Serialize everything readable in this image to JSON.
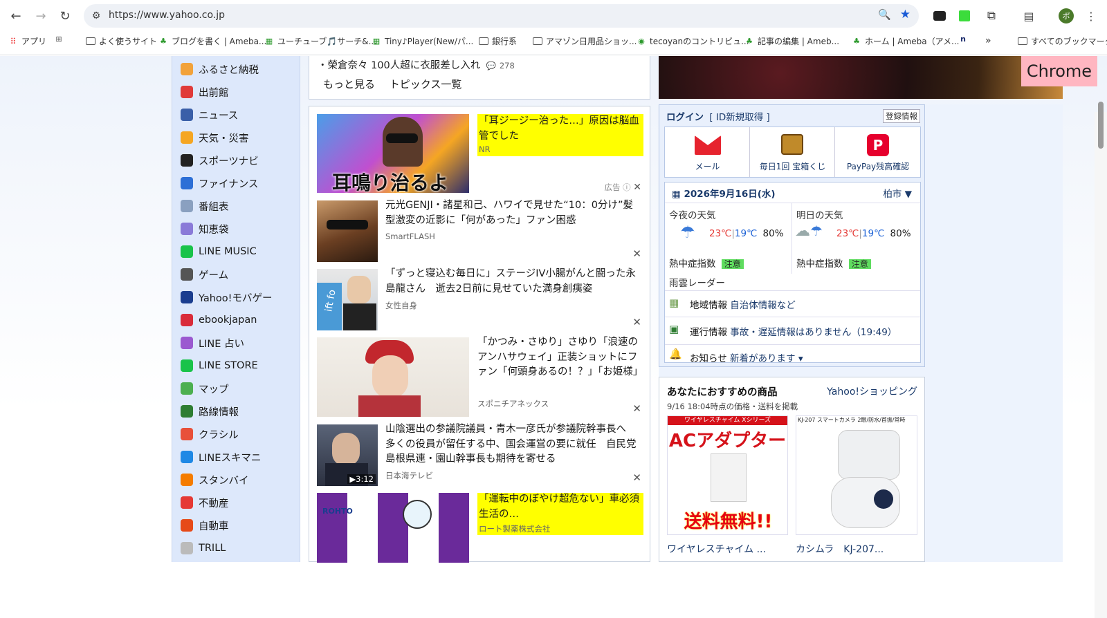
{
  "browser": {
    "url": "https://www.yahoo.co.jp",
    "profile_initial": "ポ"
  },
  "bookmarks": [
    {
      "label": "アプリ"
    },
    {
      "label": "よく使うサイト"
    },
    {
      "label": "ブログを書く | Ameba..."
    },
    {
      "label": "ユーチューブ🎵サーチ&..."
    },
    {
      "label": "Tiny♪Player(New/パ..."
    },
    {
      "label": "銀行系"
    },
    {
      "label": "アマゾン日用品ショッ..."
    },
    {
      "label": "tecoyanのコントリビュ..."
    },
    {
      "label": "記事の編集 | Ameb..."
    },
    {
      "label": "ホーム | Ameba（アメ..."
    },
    {
      "label": "»"
    },
    {
      "label": "すべてのブックマーク"
    }
  ],
  "sidebar": {
    "items": [
      {
        "label": "ふるさと納税",
        "color": "#f2a23a"
      },
      {
        "label": "出前館",
        "color": "#e03a3a"
      },
      {
        "label": "ニュース",
        "color": "#3a5fa8"
      },
      {
        "label": "天気・災害",
        "color": "#f5a623"
      },
      {
        "label": "スポーツナビ",
        "color": "#222222"
      },
      {
        "label": "ファイナンス",
        "color": "#2d6fd6"
      },
      {
        "label": "番組表",
        "color": "#8aa0c0"
      },
      {
        "label": "知恵袋",
        "color": "#8a7ad8"
      },
      {
        "label": "LINE MUSIC",
        "color": "#19c34a"
      },
      {
        "label": "ゲーム",
        "color": "#555555"
      },
      {
        "label": "Yahoo!モバゲー",
        "color": "#1a3d8f"
      },
      {
        "label": "ebookjapan",
        "color": "#d92b3a"
      },
      {
        "label": "LINE 占い",
        "color": "#9b59d0"
      },
      {
        "label": "LINE STORE",
        "color": "#19c34a"
      },
      {
        "label": "マップ",
        "color": "#4caf50"
      },
      {
        "label": "路線情報",
        "color": "#2e7d32"
      },
      {
        "label": "クラシル",
        "color": "#e8503a"
      },
      {
        "label": "LINEスキマニ",
        "color": "#1e88e5"
      },
      {
        "label": "スタンバイ",
        "color": "#f57c00"
      },
      {
        "label": "不動産",
        "color": "#e53935"
      },
      {
        "label": "自動車",
        "color": "#e64a19"
      },
      {
        "label": "TRILL",
        "color": "#bbbbbb"
      }
    ]
  },
  "topics": {
    "last_item": "・榮倉奈々 100人超に衣服差し入れ",
    "comment_count": "278",
    "more": "もっと見る",
    "list": "トピックス一覧"
  },
  "feed": [
    {
      "title": "「耳ジージー治った…」原因は脳血管でした",
      "source": "NR",
      "thumb_text": "耳鳴り治るよ",
      "ad_label": "広告",
      "is_ad": true
    },
    {
      "title": "元光GENJI・諸星和己、ハワイで見せた“10：0分け”髪型激変の近影に「何があった」ファン困惑",
      "source": "SmartFLASH",
      "is_ad": false
    },
    {
      "title": "「ずっと寝込む毎日に」ステージIV小腸がんと闘った永島龍さん　逝去2日前に見せていた満身創痍姿",
      "source": "女性自身",
      "thumb_text": "ift fo",
      "is_ad": false
    },
    {
      "title": "「かつみ・さゆり」さゆり「浪速のアンハサウェイ」正装ショットにファン「何頭身あるの！？」「お姫様」",
      "source": "スポニチアネックス",
      "is_ad": false
    },
    {
      "title": "山陰選出の参議院議員・青木一彦氏が参議院幹事長へ　多くの役員が留任する中、国会運営の要に就任　自民党島根県連・園山幹事長も期待を寄せる",
      "source": "日本海テレビ",
      "duration": "▶3:12",
      "is_ad": false
    },
    {
      "title": "「運転中のぼやけ超危ない」車必須生活の…",
      "source": "ロート製薬株式会社",
      "is_ad": true
    }
  ],
  "right": {
    "banner_tag": "Chrome",
    "login": {
      "title": "ログイン",
      "id_register": "[ ID新規取得 ]",
      "info_button": "登録情報",
      "services": [
        {
          "label": "メール"
        },
        {
          "label": "毎日1回 宝箱くじ"
        },
        {
          "label": "PayPay残高確認"
        }
      ]
    },
    "weather": {
      "date": "2026年9月16日(水)",
      "location": "柏市",
      "tonight_label": "今夜の天気",
      "tomorrow_label": "明日の天気",
      "tonight": {
        "high": "23℃",
        "low": "19℃",
        "rain": "80%"
      },
      "tomorrow": {
        "high": "23℃",
        "low": "19℃",
        "rain": "80%"
      },
      "heat_label": "熱中症指数",
      "heat_level": "注意",
      "radar": "雨雲レーダー"
    },
    "info_rows": [
      {
        "label": "地域情報",
        "value": "自治体情報など"
      },
      {
        "label": "運行情報",
        "value": "事故・遅延情報はありません（19:49）"
      },
      {
        "label": "お知らせ",
        "value": "新着があります ▾"
      }
    ],
    "shop": {
      "title": "あなたにおすすめの商品",
      "brand": "Yahoo!ショッピング",
      "timestamp": "9/16 18:04時点の価格・送料を掲載",
      "items": [
        {
          "name": "ワイヤレスチャイム ...",
          "top": "ワイヤレスチャイム Xシリーズ",
          "big": "ACアダプター",
          "promo": "送料無料!!"
        },
        {
          "name": "カシムラ　KJ-207...",
          "top": "KJ-207 スマートカメラ 2眼/防水/首振/常時"
        }
      ]
    }
  }
}
